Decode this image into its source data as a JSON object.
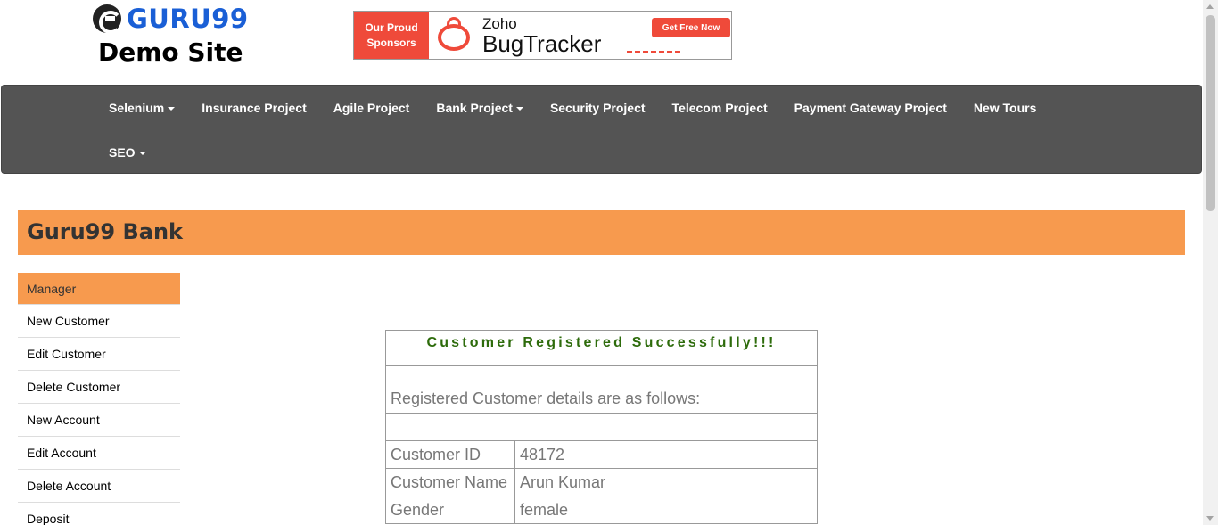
{
  "header": {
    "logo_text": "GURU99",
    "site_subtitle": "Demo Site",
    "banner": {
      "sponsor_label": "Our Proud Sponsors",
      "brand": "Zoho",
      "product": "BugTracker",
      "cta": "Get Free Now"
    }
  },
  "nav": {
    "row1": [
      {
        "label": "Selenium",
        "dropdown": true
      },
      {
        "label": "Insurance Project",
        "dropdown": false
      },
      {
        "label": "Agile Project",
        "dropdown": false
      },
      {
        "label": "Bank Project",
        "dropdown": true
      },
      {
        "label": "Security Project",
        "dropdown": false
      },
      {
        "label": "Telecom Project",
        "dropdown": false
      },
      {
        "label": "Payment Gateway Project",
        "dropdown": false
      },
      {
        "label": "New Tours",
        "dropdown": false
      }
    ],
    "row2": [
      {
        "label": "SEO",
        "dropdown": true
      }
    ]
  },
  "bank": {
    "title": "Guru99 Bank"
  },
  "sidebar": {
    "items": [
      {
        "label": "Manager",
        "active": true
      },
      {
        "label": "New Customer",
        "active": false
      },
      {
        "label": "Edit Customer",
        "active": false
      },
      {
        "label": "Delete Customer",
        "active": false
      },
      {
        "label": "New Account",
        "active": false
      },
      {
        "label": "Edit Account",
        "active": false
      },
      {
        "label": "Delete Account",
        "active": false
      },
      {
        "label": "Deposit",
        "active": false
      }
    ]
  },
  "result": {
    "heading": "Customer Registered Successfully!!!",
    "subheading": "Registered Customer details are as follows:",
    "rows": [
      {
        "label": "Customer ID",
        "value": "48172"
      },
      {
        "label": "Customer Name",
        "value": "Arun Kumar"
      },
      {
        "label": "Gender",
        "value": "female"
      }
    ]
  },
  "colors": {
    "accent_orange": "#f79a4e",
    "navbar_bg": "#545454",
    "logo_blue": "#1a5fd6",
    "success_green": "#2d6b0b",
    "banner_red": "#ef4a3a"
  }
}
